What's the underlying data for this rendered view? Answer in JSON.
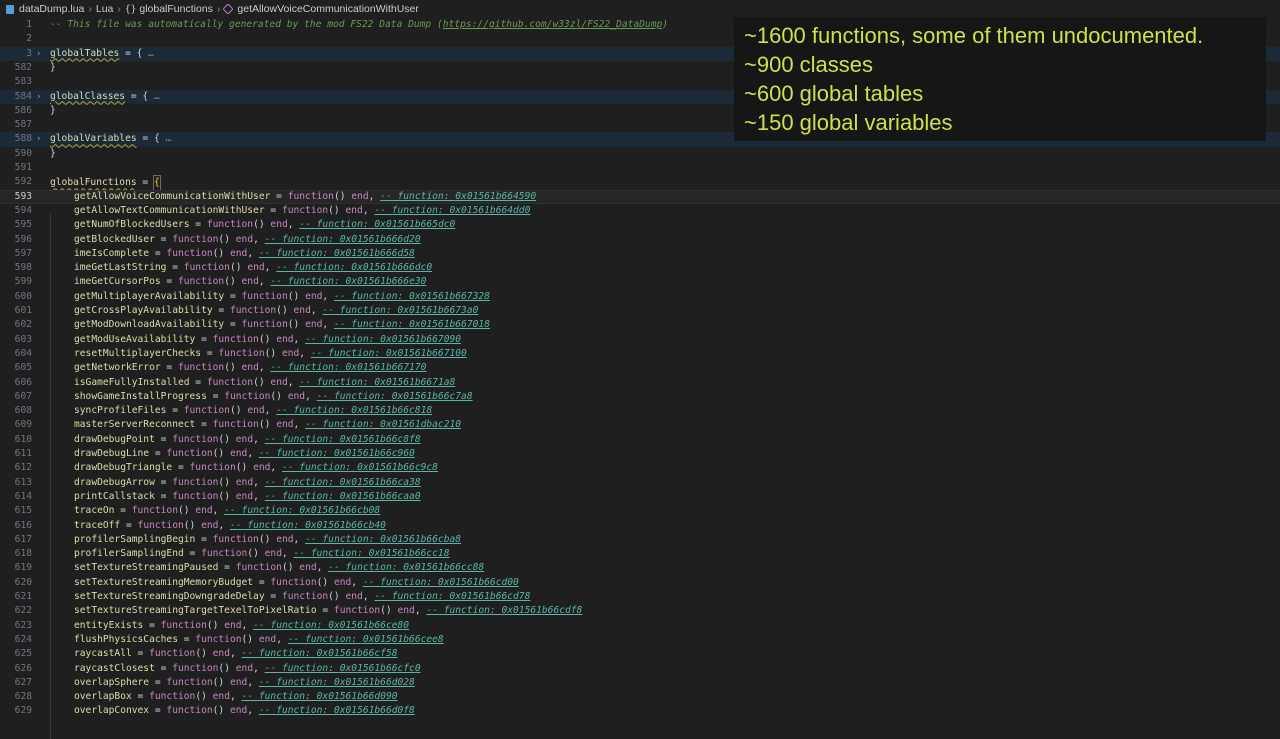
{
  "breadcrumb": {
    "file": "dataDump.lua",
    "language": "Lua",
    "table": "globalFunctions",
    "symbol": "getAllowVoiceCommunicationWithUser"
  },
  "header_lines": [
    {
      "n": "1",
      "text": "-- This file was automatically generated by the mod FS22 Data Dump (https://github.com/w33zl/FS22_DataDump)"
    },
    {
      "n": "2",
      "text": ""
    },
    {
      "n": "3",
      "name": "globalTables",
      "folded": "…"
    },
    {
      "n": "582",
      "text": "}"
    },
    {
      "n": "583",
      "text": ""
    },
    {
      "n": "584",
      "name": "globalClasses",
      "folded": "…"
    },
    {
      "n": "586",
      "text": "}"
    },
    {
      "n": "587",
      "text": ""
    },
    {
      "n": "588",
      "name": "globalVariables",
      "folded": "…"
    },
    {
      "n": "590",
      "text": "}"
    },
    {
      "n": "591",
      "text": ""
    },
    {
      "n": "592",
      "name": "globalFunctions"
    }
  ],
  "comment_prefix": "-- This file was automatically generated by the mod FS22 Data Dump (",
  "comment_url": "https://github.com/w33zl/FS22_DataDump",
  "comment_suffix": ")",
  "functions": [
    {
      "n": "593",
      "name": "getAllowVoiceCommunicationWithUser",
      "addr": "0x01561b664590"
    },
    {
      "n": "594",
      "name": "getAllowTextCommunicationWithUser",
      "addr": "0x01561b664dd0"
    },
    {
      "n": "595",
      "name": "getNumOfBlockedUsers",
      "addr": "0x01561b665dc0"
    },
    {
      "n": "596",
      "name": "getBlockedUser",
      "addr": "0x01561b666d20"
    },
    {
      "n": "597",
      "name": "imeIsComplete",
      "addr": "0x01561b666d58"
    },
    {
      "n": "598",
      "name": "imeGetLastString",
      "addr": "0x01561b666dc0"
    },
    {
      "n": "599",
      "name": "imeGetCursorPos",
      "addr": "0x01561b666e30"
    },
    {
      "n": "600",
      "name": "getMultiplayerAvailability",
      "addr": "0x01561b667328"
    },
    {
      "n": "601",
      "name": "getCrossPlayAvailability",
      "addr": "0x01561b6673a0"
    },
    {
      "n": "602",
      "name": "getModDownloadAvailability",
      "addr": "0x01561b667018"
    },
    {
      "n": "603",
      "name": "getModUseAvailability",
      "addr": "0x01561b667090"
    },
    {
      "n": "604",
      "name": "resetMultiplayerChecks",
      "addr": "0x01561b667100"
    },
    {
      "n": "605",
      "name": "getNetworkError",
      "addr": "0x01561b667170"
    },
    {
      "n": "606",
      "name": "isGameFullyInstalled",
      "addr": "0x01561b6671a8"
    },
    {
      "n": "607",
      "name": "showGameInstallProgress",
      "addr": "0x01561b66c7a8"
    },
    {
      "n": "608",
      "name": "syncProfileFiles",
      "addr": "0x01561b66c818"
    },
    {
      "n": "609",
      "name": "masterServerReconnect",
      "addr": "0x01561dbac210"
    },
    {
      "n": "610",
      "name": "drawDebugPoint",
      "addr": "0x01561b66c8f8"
    },
    {
      "n": "611",
      "name": "drawDebugLine",
      "addr": "0x01561b66c960"
    },
    {
      "n": "612",
      "name": "drawDebugTriangle",
      "addr": "0x01561b66c9c8"
    },
    {
      "n": "613",
      "name": "drawDebugArrow",
      "addr": "0x01561b66ca38"
    },
    {
      "n": "614",
      "name": "printCallstack",
      "addr": "0x01561b66caa0"
    },
    {
      "n": "615",
      "name": "traceOn",
      "addr": "0x01561b66cb08"
    },
    {
      "n": "616",
      "name": "traceOff",
      "addr": "0x01561b66cb40"
    },
    {
      "n": "617",
      "name": "profilerSamplingBegin",
      "addr": "0x01561b66cba8"
    },
    {
      "n": "618",
      "name": "profilerSamplingEnd",
      "addr": "0x01561b66cc18"
    },
    {
      "n": "619",
      "name": "setTextureStreamingPaused",
      "addr": "0x01561b66cc88"
    },
    {
      "n": "620",
      "name": "setTextureStreamingMemoryBudget",
      "addr": "0x01561b66cd00"
    },
    {
      "n": "621",
      "name": "setTextureStreamingDowngradeDelay",
      "addr": "0x01561b66cd78"
    },
    {
      "n": "622",
      "name": "setTextureStreamingTargetTexelToPixelRatio",
      "addr": "0x01561b66cdf8"
    },
    {
      "n": "623",
      "name": "entityExists",
      "addr": "0x01561b66ce80"
    },
    {
      "n": "624",
      "name": "flushPhysicsCaches",
      "addr": "0x01561b66cee8"
    },
    {
      "n": "625",
      "name": "raycastAll",
      "addr": "0x01561b66cf58"
    },
    {
      "n": "626",
      "name": "raycastClosest",
      "addr": "0x01561b66cfc0"
    },
    {
      "n": "627",
      "name": "overlapSphere",
      "addr": "0x01561b66d028"
    },
    {
      "n": "628",
      "name": "overlapBox",
      "addr": "0x01561b66d090"
    },
    {
      "n": "629",
      "name": "overlapConvex",
      "addr": "0x01561b66d0f8"
    }
  ],
  "tokens": {
    "equals_open": " = {",
    "fold_marker": "…",
    "close": "}",
    "assign": " = ",
    "function_kw": "function",
    "parens": "()",
    "end_kw": "end",
    "comma": ",",
    "hint_prefix": "-- function: "
  },
  "overlay": {
    "lines": [
      "~1600 functions, some of them undocumented.",
      "~900 classes",
      "~600 global tables",
      "~150 global variables"
    ]
  },
  "colors": {
    "background": "#1f1f1f",
    "overlay_text": "#cfe04a",
    "comment": "#6a9955",
    "keyword": "#c586c0",
    "function_name": "#dcdcaa",
    "hint": "#59b5a6"
  }
}
